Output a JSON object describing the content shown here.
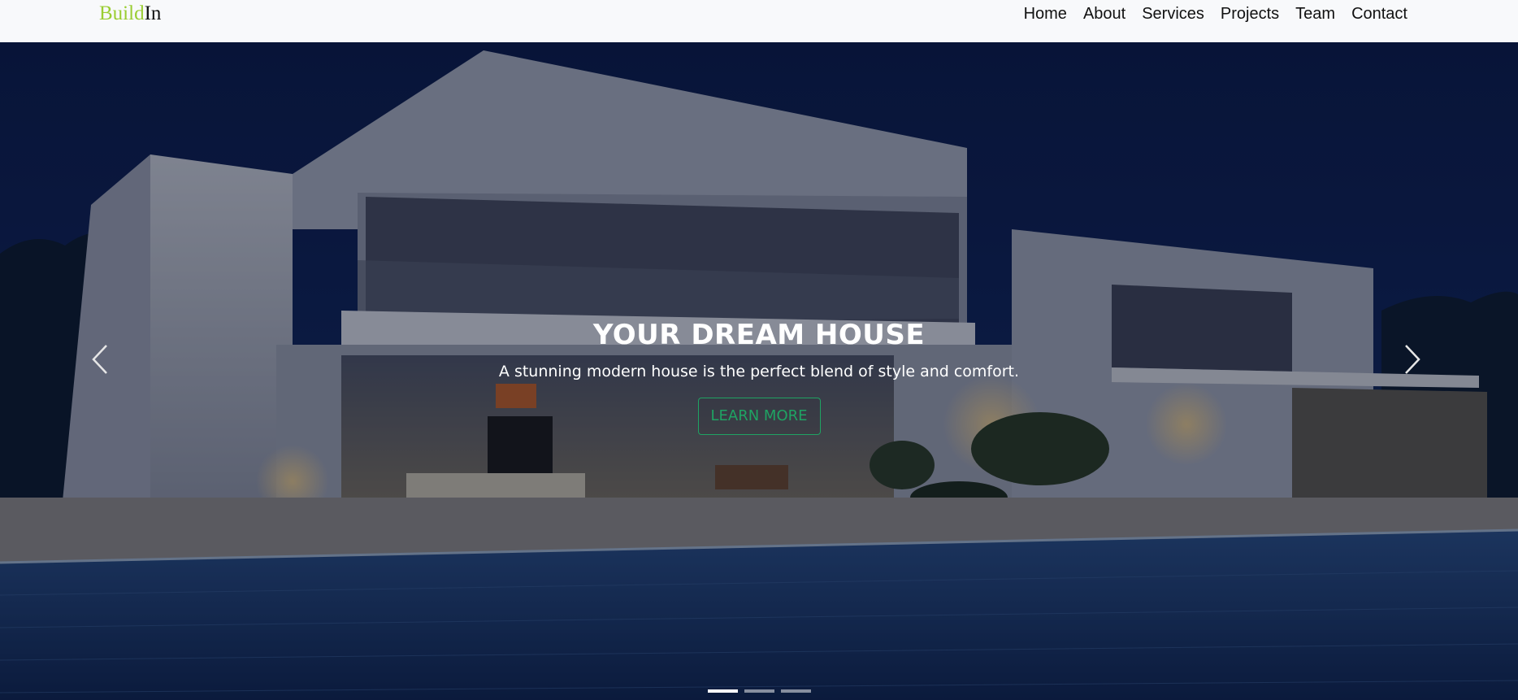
{
  "brand": {
    "part1": "Build",
    "part2": "In"
  },
  "nav": {
    "items": [
      {
        "label": "Home"
      },
      {
        "label": "About"
      },
      {
        "label": "Services"
      },
      {
        "label": "Projects"
      },
      {
        "label": "Team"
      },
      {
        "label": "Contact"
      }
    ]
  },
  "hero": {
    "title": "YOUR DREAM HOUSE",
    "subtitle": "A stunning modern house is the perfect blend of style and comfort.",
    "button_label": "LEARN MORE",
    "prev_icon": "chevron-left-icon",
    "next_icon": "chevron-right-icon",
    "slides_count": 3,
    "active_slide": 1
  },
  "colors": {
    "brand_accent": "#9acd32",
    "button_accent": "#1fa363",
    "navbar_bg": "#f8f9fb",
    "sky": "#0b1b4a"
  }
}
